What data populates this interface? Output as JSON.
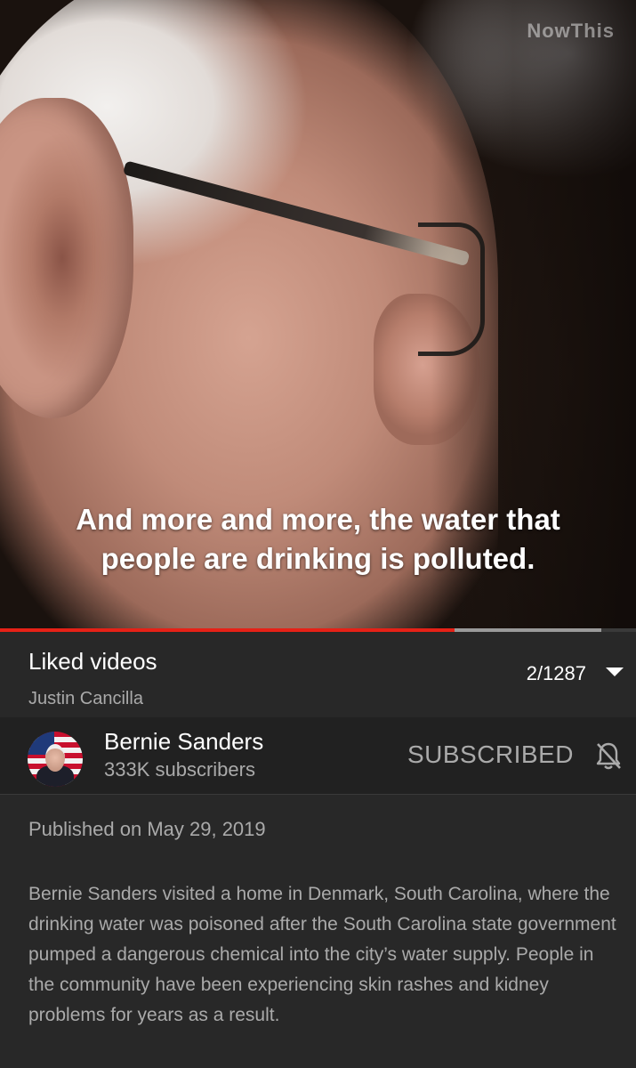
{
  "video": {
    "watermark": "NowThis",
    "caption_line1": "And more and more, the water that",
    "caption_line2": "people are drinking is polluted.",
    "progress_played": 0.715,
    "progress_buffered": 0.945,
    "colors": {
      "played": "#e62117",
      "buffered": "#9a9a9a"
    }
  },
  "playlist": {
    "title": "Liked videos",
    "owner": "Justin Cancilla",
    "position": "2/1287",
    "expand_icon": "chevron-down-icon"
  },
  "channel": {
    "name": "Bernie Sanders",
    "subscribers": "333K subscribers",
    "subscribe_label": "SUBSCRIBED",
    "notifications_icon": "bell-off-icon"
  },
  "description": {
    "published": "Published on May 29, 2019",
    "text": "Bernie Sanders visited a home in Denmark, South Carolina, where the drinking water was poisoned after the South Carolina state government pumped a dangerous chemical into the city’s water supply. People in the community have been experiencing skin rashes and kidney problems for years as a result."
  }
}
